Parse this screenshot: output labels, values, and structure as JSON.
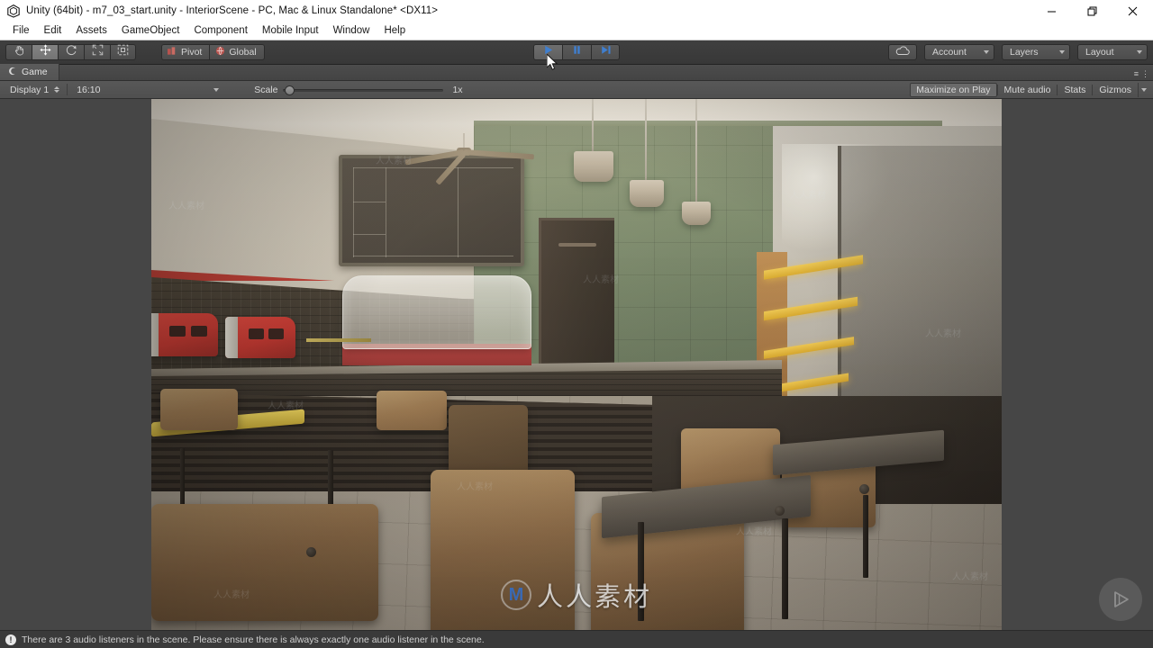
{
  "window": {
    "title": "Unity (64bit) - m7_03_start.unity - InteriorScene - PC, Mac & Linux Standalone* <DX11>",
    "app_icon": "unity-logo-icon",
    "controls": {
      "minimize": "—",
      "maximize": "❐",
      "close": "✕"
    }
  },
  "menubar": {
    "items": [
      {
        "label": "File"
      },
      {
        "label": "Edit"
      },
      {
        "label": "Assets"
      },
      {
        "label": "GameObject"
      },
      {
        "label": "Component"
      },
      {
        "label": "Mobile Input"
      },
      {
        "label": "Window"
      },
      {
        "label": "Help"
      }
    ]
  },
  "toolbar": {
    "tools": [
      {
        "name": "hand-tool",
        "icon": "hand-icon",
        "active": false
      },
      {
        "name": "move-tool",
        "icon": "move-icon",
        "active": true
      },
      {
        "name": "rotate-tool",
        "icon": "rotate-icon",
        "active": false
      },
      {
        "name": "scale-tool",
        "icon": "scale-icon",
        "active": false
      },
      {
        "name": "rect-tool",
        "icon": "rect-transform-icon",
        "active": false
      }
    ],
    "pivot_label": "Pivot",
    "global_label": "Global",
    "playback": {
      "play": "play-icon",
      "pause": "pause-icon",
      "step": "step-icon",
      "is_playing": true
    },
    "cloud_label": "cloud-icon",
    "account_label": "Account",
    "layers_label": "Layers",
    "layout_label": "Layout"
  },
  "game_panel": {
    "tab_label": "Game",
    "tab_icon": "game-view-icon",
    "display_label": "Display 1",
    "aspect_label": "16:10",
    "scale_label": "Scale",
    "scale_value": "1x",
    "scale_percent": 2,
    "maximize_on_play": "Maximize on Play",
    "mute_audio": "Mute audio",
    "stats": "Stats",
    "gizmos": "Gizmos",
    "maximize_active": true
  },
  "game_view": {
    "scene_name": "InteriorScene",
    "description": "Rendered cafe / diner interior: cream ceiling, green tiled wall with chalkboard menu, three pendant lamps, ceiling fan, dark door, glass display case on a counter, red espresso machines, yellow glowing shelves, bright window and glass partition at right, wooden chairs with dark metal legs, yellow and dark tables on a tiled floor.",
    "watermark_text": "人人素材",
    "watermark_logo": "m-circle-logo-icon",
    "tile_watermark_text": "人人素材",
    "play_overlay_icon": "play-overlay-icon"
  },
  "statusbar": {
    "icon": "warning-icon",
    "icon_glyph": "!",
    "message": "There are 3 audio listeners in the scene. Please ensure there is always exactly one audio listener in the scene."
  },
  "colors": {
    "toolbar_bg": "#3c3c3c",
    "panel_bg": "#555555",
    "letterbox": "#464646",
    "status_bg": "#3a3a3a",
    "play_accent": "#3f7fd0",
    "titlebar_bg": "#ffffff"
  }
}
